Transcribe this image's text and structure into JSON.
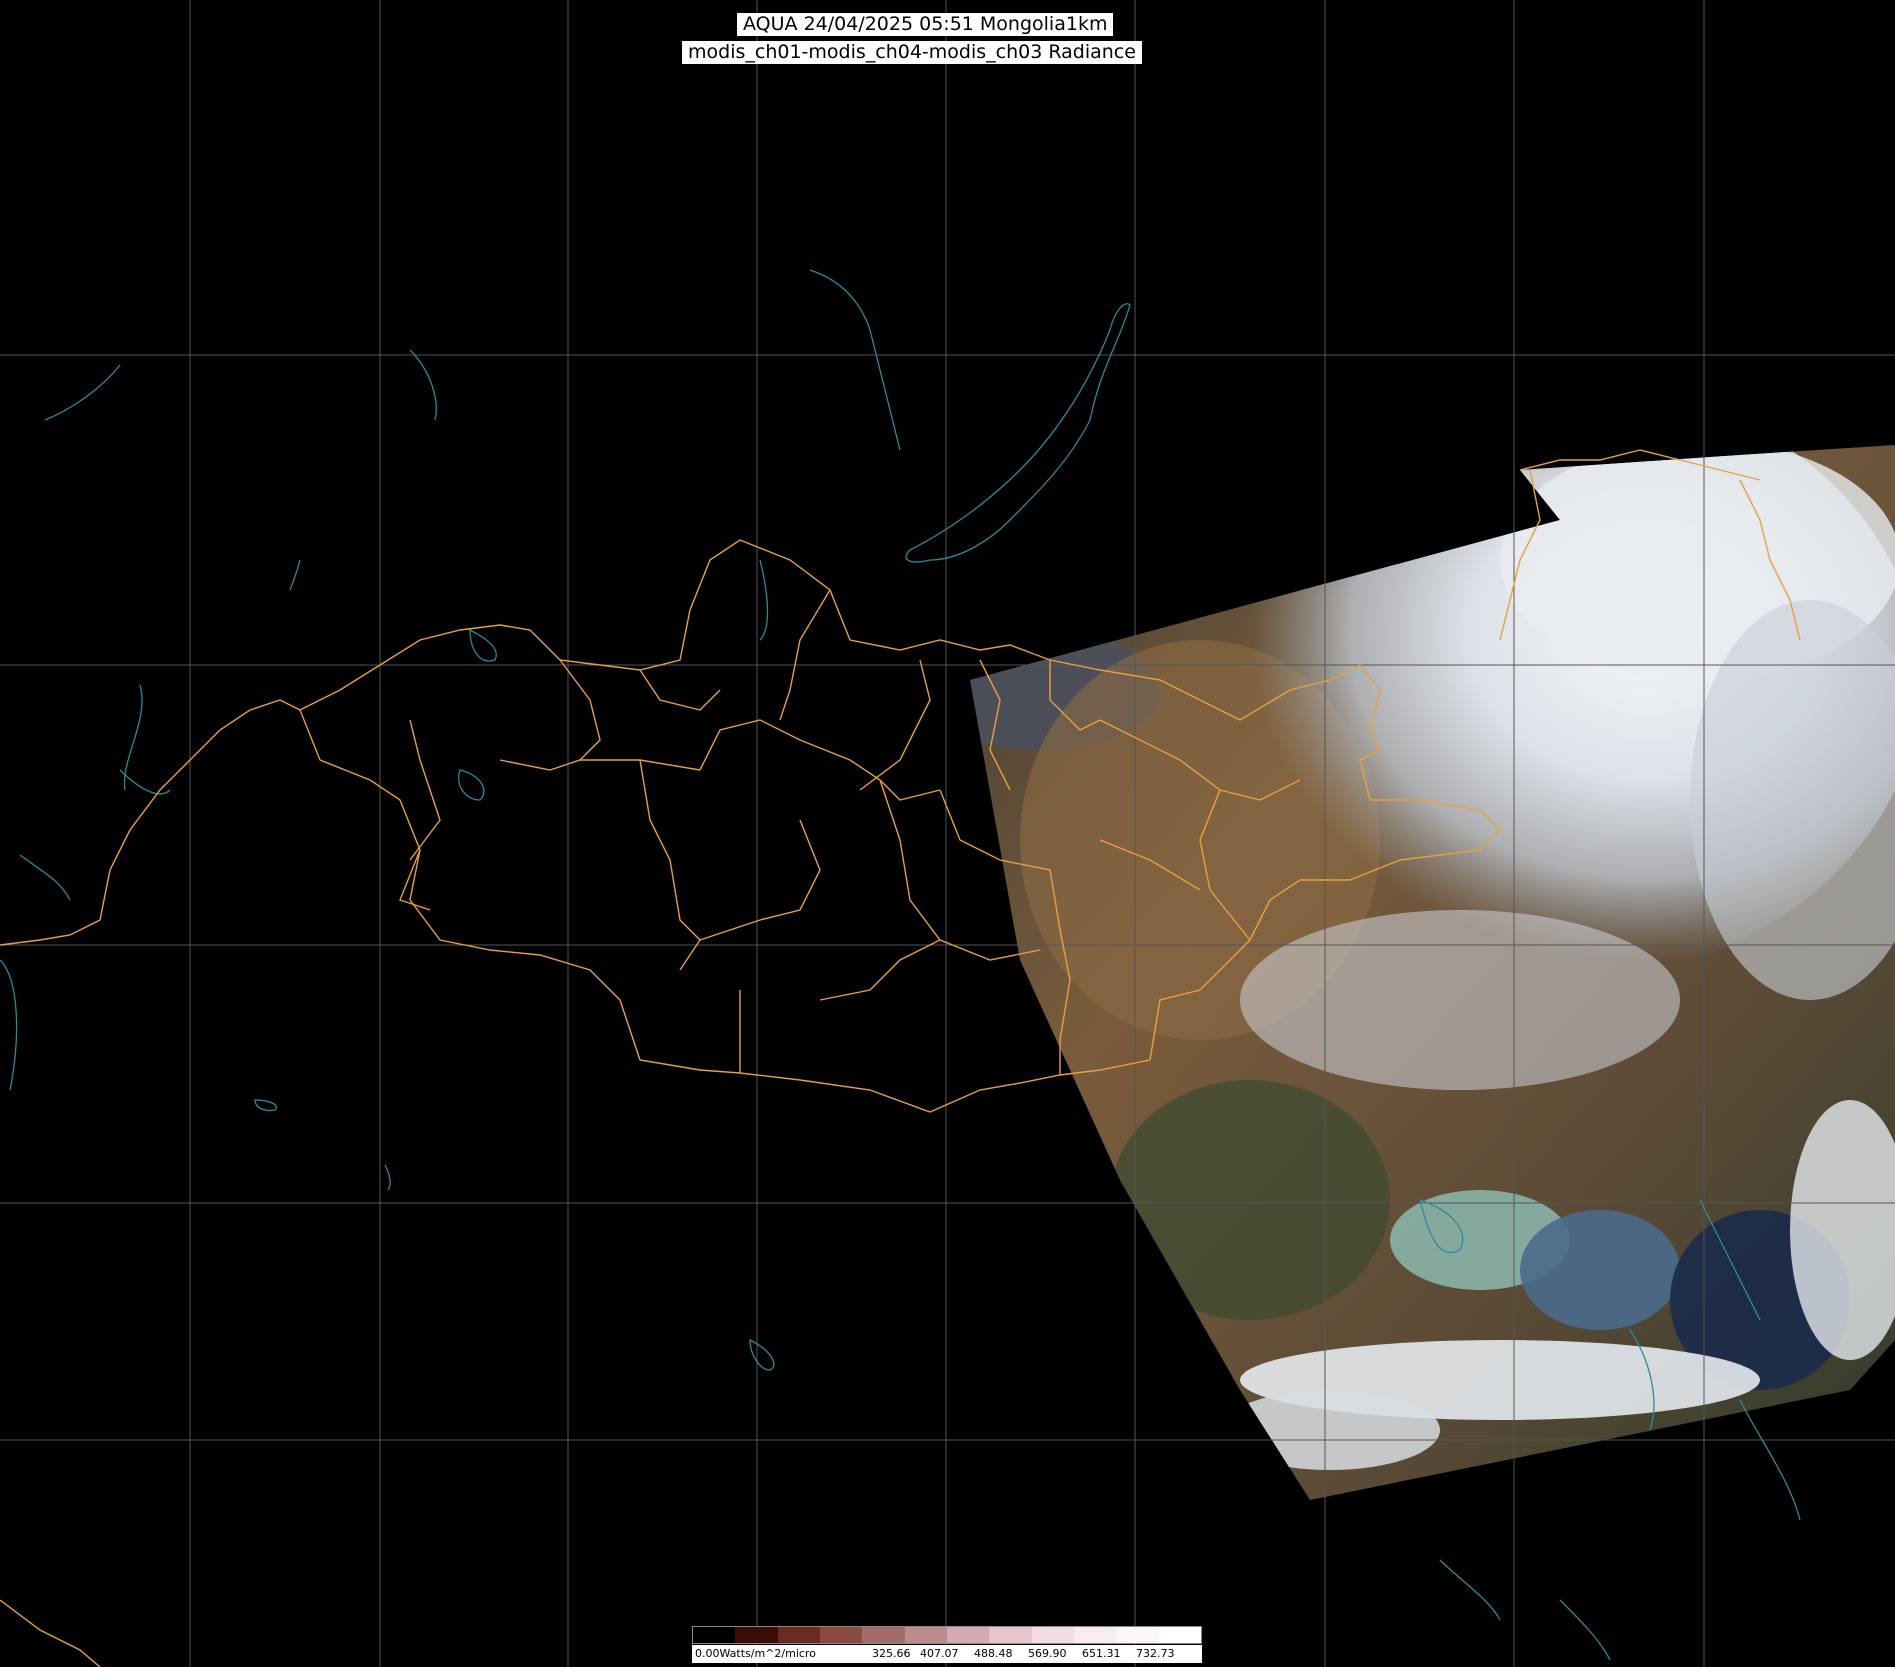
{
  "title": {
    "line1": "AQUA 24/04/2025 05:51 Mongolia1km",
    "line2": "modis_ch01-modis_ch04-modis_ch03 Radiance"
  },
  "colorbar": {
    "unit_label": "0.00Watts/m^2/micro",
    "tick_labels": [
      "325.66",
      "407.07",
      "488.48",
      "569.90",
      "651.31",
      "732.73"
    ],
    "colors": [
      "#000000",
      "#3a0d08",
      "#6a2a22",
      "#8a4a44",
      "#a36c68",
      "#bb8c8a",
      "#d3aab0",
      "#e6c6cc",
      "#f3dde2",
      "#f8ecef",
      "#fcf6f8",
      "#ffffff"
    ]
  },
  "colors": {
    "background": "#000000",
    "graticule": "#555555",
    "border": "#e8a040",
    "coast": "#2a8c9a"
  }
}
